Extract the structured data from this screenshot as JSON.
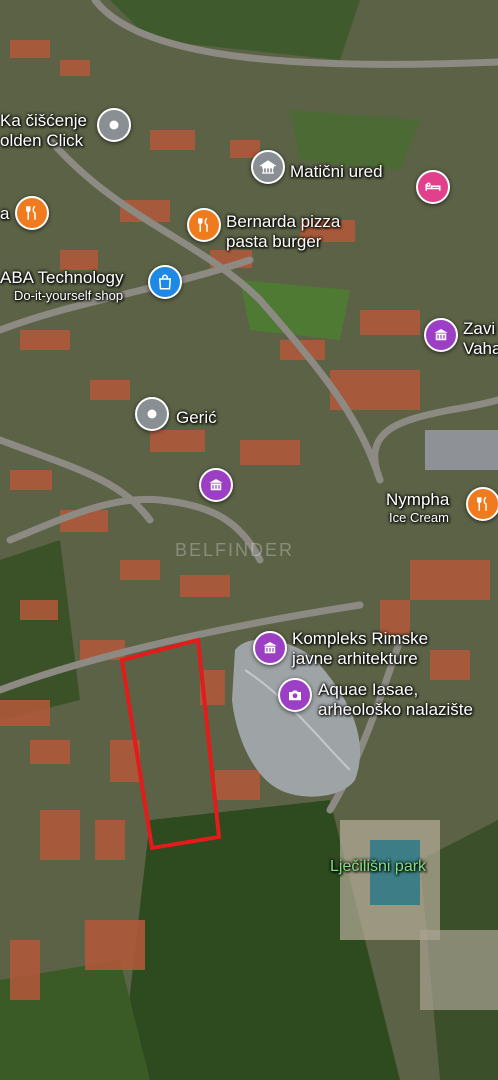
{
  "places": [
    {
      "id": "golden-click",
      "lines": [
        "Ka čišćenje",
        "olden Click"
      ],
      "icon": "map-pin-icon",
      "color": "#8a8f94"
    },
    {
      "id": "maticni-ured",
      "lines": [
        "Matični ured"
      ],
      "icon": "government-icon",
      "color": "#8a8f94"
    },
    {
      "id": "hotel",
      "lines": [],
      "icon": "bed-icon",
      "color": "#e0408c"
    },
    {
      "id": "restaurant-left",
      "lines": [
        "a"
      ],
      "icon": "fork-knife-icon",
      "color": "#f07a1e"
    },
    {
      "id": "bernarda-pizza",
      "lines": [
        "Bernarda pizza",
        "pasta burger"
      ],
      "icon": "fork-knife-icon",
      "color": "#f07a1e"
    },
    {
      "id": "aba-technology",
      "lines": [
        "ABA Technology",
        "Do-it-yourself shop"
      ],
      "icon": "shopping-bag-icon",
      "color": "#1e88e5"
    },
    {
      "id": "zavicajni",
      "lines": [
        "Zavi",
        "Vaha"
      ],
      "icon": "museum-icon",
      "color": "#9c3fc4"
    },
    {
      "id": "geric",
      "lines": [
        "Gerić"
      ],
      "icon": "map-pin-icon",
      "color": "#8a8f94"
    },
    {
      "id": "museum-center",
      "lines": [],
      "icon": "museum-icon",
      "color": "#9c3fc4"
    },
    {
      "id": "nympha",
      "lines": [
        "Nympha",
        "Ice Cream"
      ],
      "icon": "fork-knife-icon",
      "color": "#f07a1e"
    },
    {
      "id": "kompleks-rimske",
      "lines": [
        "Kompleks Rimske",
        "javne arhitekture"
      ],
      "icon": "museum-icon",
      "color": "#9c3fc4"
    },
    {
      "id": "aquae-iasae",
      "lines": [
        "Aquae Iasae,",
        "arheološko nalazište"
      ],
      "icon": "camera-icon",
      "color": "#9c3fc4"
    }
  ],
  "area_labels": {
    "park": "Lječilišni park"
  },
  "watermark": "BELFINDER",
  "parcel_outline_color": "#e31b1b"
}
